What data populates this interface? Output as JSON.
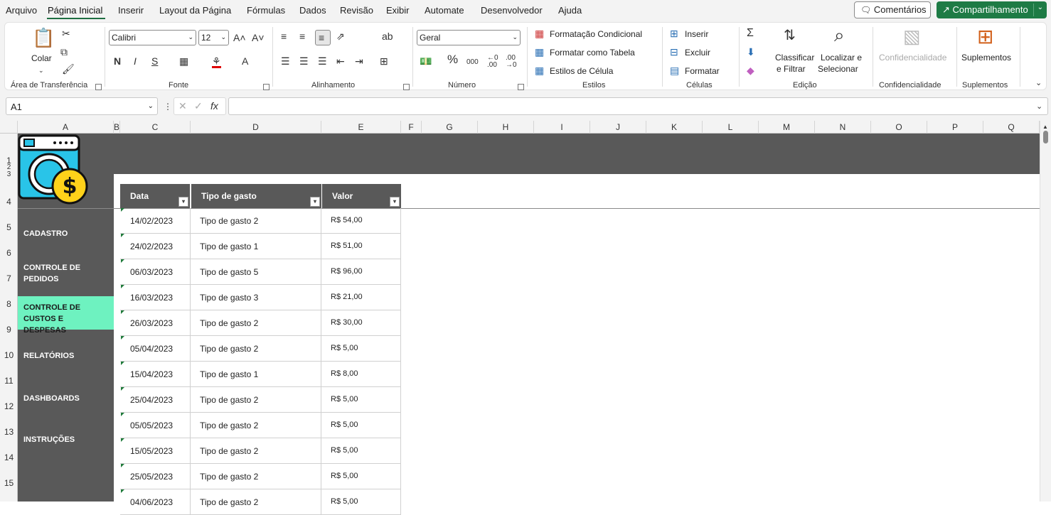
{
  "menu": {
    "tabs": [
      "Arquivo",
      "Página Inicial",
      "Inserir",
      "Layout da Página",
      "Fórmulas",
      "Dados",
      "Revisão",
      "Exibir",
      "Automate",
      "Desenvolvedor",
      "Ajuda"
    ],
    "active_tab": "Página Inicial",
    "comments_label": "Comentários",
    "share_label": "Compartilhamento"
  },
  "ribbon": {
    "clipboard": {
      "paste_label": "Colar",
      "group_label": "Área de Transferência"
    },
    "font": {
      "font_name": "Calibri",
      "font_size": "12",
      "group_label": "Fonte",
      "bold": "N",
      "italic": "I",
      "underline": "S"
    },
    "alignment": {
      "group_label": "Alinhamento"
    },
    "number": {
      "format": "Geral",
      "group_label": "Número"
    },
    "styles": {
      "conditional": "Formatação Condicional",
      "as_table": "Formatar como Tabela",
      "cell_styles": "Estilos de Célula",
      "group_label": "Estilos"
    },
    "cells": {
      "insert": "Inserir",
      "delete": "Excluir",
      "format": "Formatar",
      "group_label": "Células"
    },
    "editing": {
      "sort_filter_1": "Classificar",
      "sort_filter_2": "e Filtrar",
      "find_select_1": "Localizar e",
      "find_select_2": "Selecionar",
      "group_label": "Edição"
    },
    "sensitivity": {
      "label": "Confidencialidade",
      "group_label": "Confidencialidade"
    },
    "addins": {
      "label": "Suplementos",
      "group_label": "Suplementos"
    }
  },
  "formula_bar": {
    "name_box": "A1",
    "fx": "fx",
    "value": ""
  },
  "columns": [
    "A",
    "B",
    "C",
    "D",
    "E",
    "F",
    "G",
    "H",
    "I",
    "J",
    "K",
    "L",
    "M",
    "N",
    "O",
    "P",
    "Q"
  ],
  "rows": [
    "1",
    "2",
    "3",
    "4",
    "5",
    "6",
    "7",
    "8",
    "9",
    "10",
    "11",
    "12",
    "13",
    "14",
    "15"
  ],
  "sidebar": {
    "items": [
      {
        "label": "CADASTRO"
      },
      {
        "label": "CONTROLE DE PEDIDOS"
      },
      {
        "label": "CONTROLE DE CUSTOS E DESPESAS",
        "active": true
      },
      {
        "label": "RELATÓRIOS"
      },
      {
        "label": "DASHBOARDS"
      },
      {
        "label": "INSTRUÇÕES"
      }
    ]
  },
  "table": {
    "headers": [
      "Data",
      "Tipo de gasto",
      "Valor"
    ],
    "rows": [
      [
        "14/02/2023",
        "Tipo de gasto 2",
        "R$ 54,00"
      ],
      [
        "24/02/2023",
        "Tipo de gasto 1",
        "R$ 51,00"
      ],
      [
        "06/03/2023",
        "Tipo de gasto 5",
        "R$ 96,00"
      ],
      [
        "16/03/2023",
        "Tipo de gasto 3",
        "R$ 21,00"
      ],
      [
        "26/03/2023",
        "Tipo de gasto 2",
        "R$ 30,00"
      ],
      [
        "05/04/2023",
        "Tipo de gasto 2",
        "R$ 5,00"
      ],
      [
        "15/04/2023",
        "Tipo de gasto 1",
        "R$ 8,00"
      ],
      [
        "25/04/2023",
        "Tipo de gasto 2",
        "R$ 5,00"
      ],
      [
        "05/05/2023",
        "Tipo de gasto 2",
        "R$ 5,00"
      ],
      [
        "15/05/2023",
        "Tipo de gasto 2",
        "R$ 5,00"
      ],
      [
        "25/05/2023",
        "Tipo de gasto 2",
        "R$ 5,00"
      ],
      [
        "04/06/2023",
        "Tipo de gasto 2",
        "R$ 5,00"
      ]
    ]
  },
  "colors": {
    "accent": "#1e7b45",
    "banner": "#595959",
    "active_nav": "#6ef2c0"
  }
}
